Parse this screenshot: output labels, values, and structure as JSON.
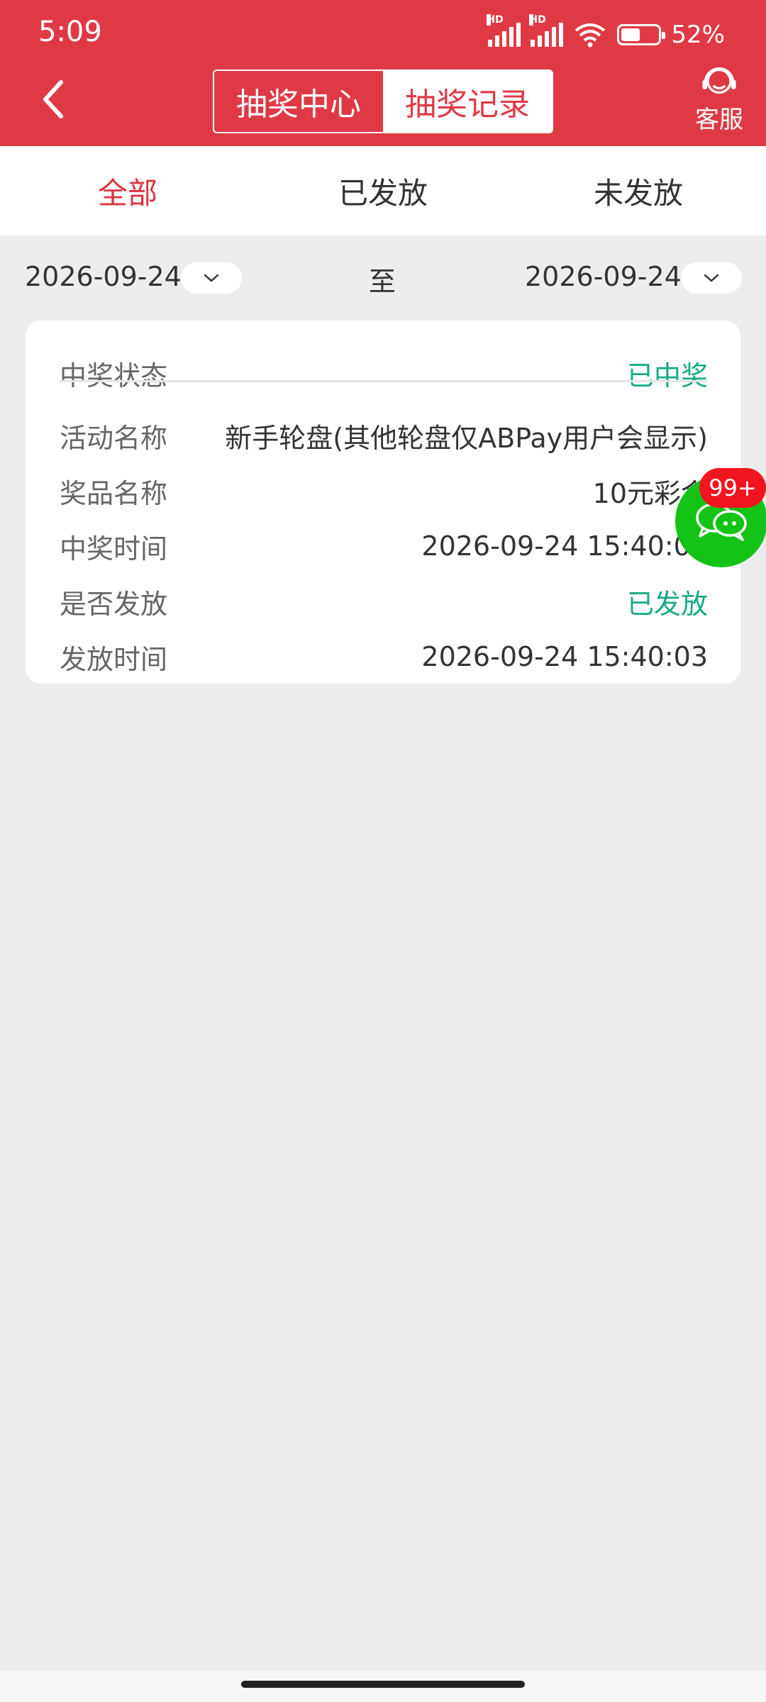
{
  "status_bar": {
    "time": "5:09",
    "battery_text": "52%",
    "battery_level": 0.52,
    "signal_label": "HD"
  },
  "header": {
    "segments": [
      "抽奖中心",
      "抽奖记录"
    ],
    "active_segment": "抽奖记录",
    "service_label": "客服",
    "accent_color": "#df3a44"
  },
  "tabs": {
    "items": [
      "全部",
      "已发放",
      "未发放"
    ],
    "active": "全部"
  },
  "date_filter": {
    "start": "2026-09-24",
    "separator": "至",
    "end": "2026-09-24"
  },
  "record": {
    "rows": [
      {
        "label": "中奖状态",
        "value": "已中奖",
        "highlight": true
      },
      {
        "label": "活动名称",
        "value": "新手轮盘(其他轮盘仅ABPay用户会显示)",
        "highlight": false
      },
      {
        "label": "奖品名称",
        "value": "10元彩金",
        "highlight": false
      },
      {
        "label": "中奖时间",
        "value": "2026-09-24 15:40:03",
        "highlight": false
      },
      {
        "label": "是否发放",
        "value": "已发放",
        "highlight": true
      },
      {
        "label": "发放时间",
        "value": "2026-09-24 15:40:03",
        "highlight": false
      }
    ],
    "highlight_color": "#17a887"
  },
  "floating_chat": {
    "badge": "99+",
    "icon": "chat-bubbles-icon"
  }
}
